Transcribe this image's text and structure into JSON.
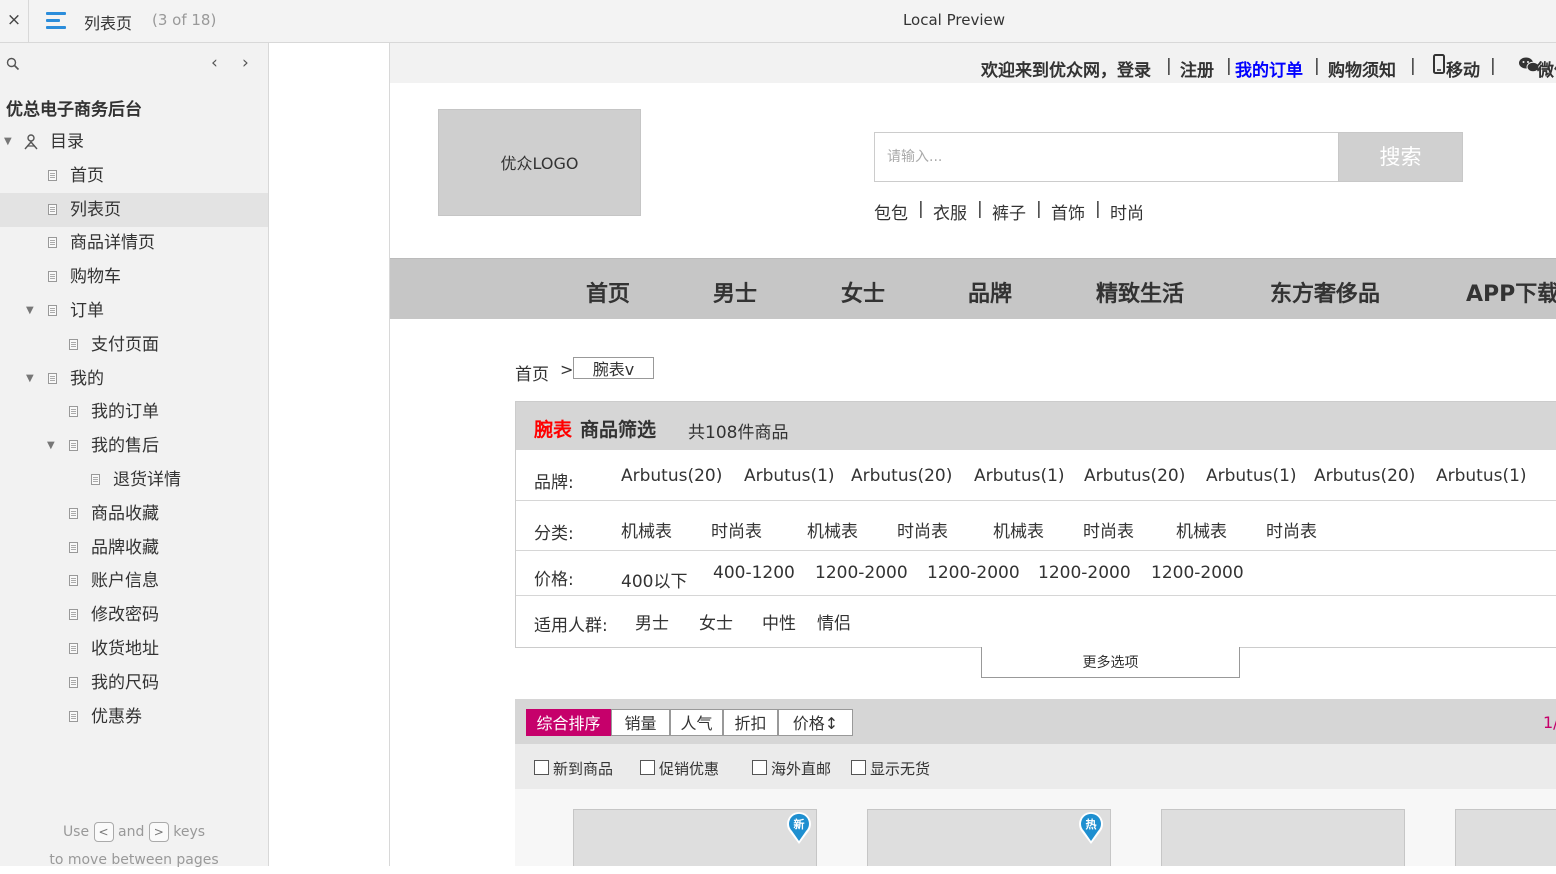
{
  "toolbar": {
    "close": "×",
    "page_name": "列表页",
    "page_count": "(3 of 18)",
    "preview_title": "Local Preview"
  },
  "sidebar": {
    "prev": "‹",
    "next": "›",
    "project_title": "优总电子商务后台",
    "items": [
      {
        "label": "目录",
        "level": 0,
        "expanded": true,
        "icon": "sitemap-icon"
      },
      {
        "label": "首页",
        "level": 1
      },
      {
        "label": "列表页",
        "level": 1,
        "selected": true
      },
      {
        "label": "商品详情页",
        "level": 1
      },
      {
        "label": "购物车",
        "level": 1
      },
      {
        "label": "订单",
        "level": 1,
        "expanded": true
      },
      {
        "label": "支付页面",
        "level": 2
      },
      {
        "label": "我的",
        "level": 1,
        "expanded": true
      },
      {
        "label": "我的订单",
        "level": 2
      },
      {
        "label": "我的售后",
        "level": 2,
        "expanded": true
      },
      {
        "label": "退货详情",
        "level": 3
      },
      {
        "label": "商品收藏",
        "level": 2
      },
      {
        "label": "品牌收藏",
        "level": 2
      },
      {
        "label": "账户信息",
        "level": 2
      },
      {
        "label": "修改密码",
        "level": 2
      },
      {
        "label": "收货地址",
        "level": 2
      },
      {
        "label": "我的尺码",
        "level": 2
      },
      {
        "label": "优惠券",
        "level": 2
      }
    ],
    "hint": {
      "use": "Use",
      "and": "and",
      "keys": "keys",
      "line2": "to move between pages",
      "key_prev": "<",
      "key_next": ">"
    }
  },
  "site": {
    "topnav": {
      "welcome": "欢迎来到优众网，登录",
      "register": "注册",
      "my_orders": "我的订单",
      "shopping_notice": "购物须知",
      "mobile": "移动",
      "wechat": "微信",
      "sep": "|"
    },
    "logo": "优众LOGO",
    "search": {
      "placeholder": "请输入...",
      "button": "搜索"
    },
    "hot_words": [
      "包包",
      "衣服",
      "裤子",
      "首饰",
      "时尚"
    ],
    "categories": [
      "首页",
      "男士",
      "女士",
      "品牌",
      "精致生活",
      "东方奢侈品",
      "APP下载"
    ],
    "breadcrumb": {
      "home": "首页",
      "gt": ">",
      "current": "腕表v"
    },
    "filter": {
      "title_red": "腕表",
      "title": "商品筛选",
      "count": "共108件商品",
      "brand_label": "品牌:",
      "brands": [
        "Arbutus(20)",
        "Arbutus(1)",
        "Arbutus(20)",
        "Arbutus(1)",
        "Arbutus(20)",
        "Arbutus(1)",
        "Arbutus(20)",
        "Arbutus(1)"
      ],
      "category_label": "分类:",
      "categories": [
        "机械表",
        "时尚表",
        "机械表",
        "时尚表",
        "机械表",
        "时尚表",
        "机械表",
        "时尚表"
      ],
      "price_label": "价格:",
      "prices": [
        "400以下",
        "400-1200",
        "1200-2000",
        "1200-2000",
        "1200-2000",
        "1200-2000"
      ],
      "crowd_label": "适用人群:",
      "crowds": [
        "男士",
        "女士",
        "中性",
        "情侣"
      ],
      "more": "更多选项"
    },
    "sort": {
      "options": [
        "综合排序",
        "销量",
        "人气",
        "折扣",
        "价格↕"
      ],
      "page_indicator": "1/"
    },
    "checks": [
      "新到商品",
      "促销优惠",
      "海外直邮",
      "显示无货"
    ],
    "products": [
      {
        "badge": "新"
      },
      {
        "badge": "热"
      },
      {
        "badge": ""
      },
      {
        "badge": ""
      }
    ],
    "colors": {
      "accent": "#c6006b",
      "link_blue": "#0000ff",
      "red": "#ff0000",
      "badge_blue": "#1e8fd0"
    }
  }
}
